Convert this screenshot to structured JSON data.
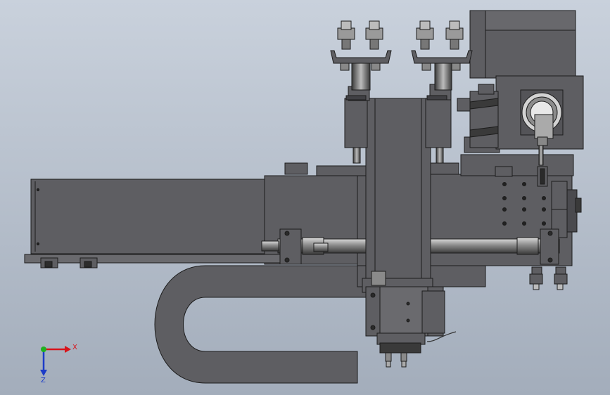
{
  "viewport": {
    "background_top": "#c9d1dc",
    "background_bottom": "#a3adbb",
    "part_color": "#5e5e62",
    "edge_color": "#1c1c1c"
  },
  "triad": {
    "x_label": "X",
    "z_label": "Z",
    "x_color": "#d8141b",
    "y_color": "#1fb21f",
    "z_color": "#1c3cc8"
  }
}
